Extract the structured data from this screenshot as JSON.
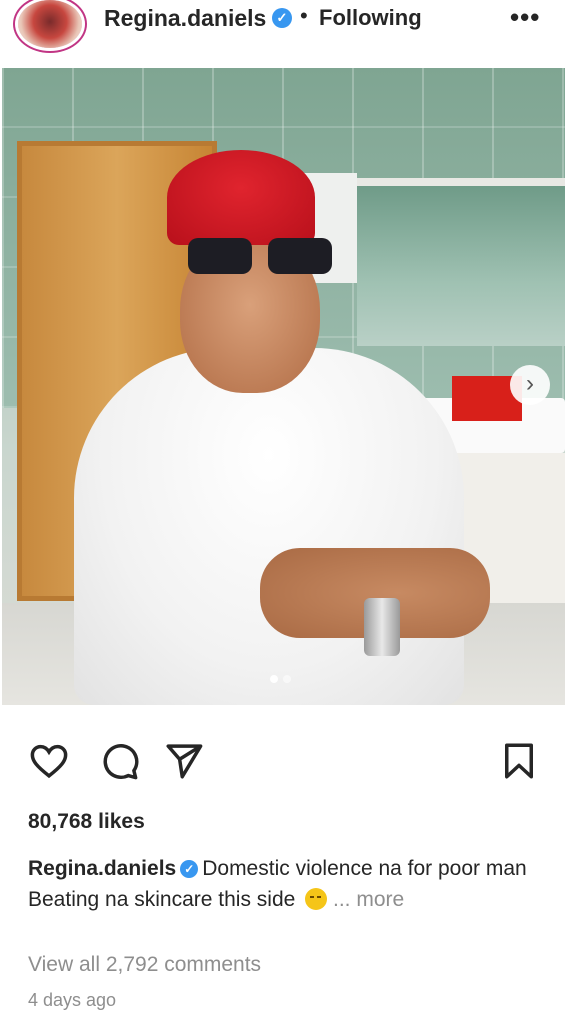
{
  "header": {
    "username": "Regina.daniels",
    "verified_glyph": "✓",
    "separator": "•",
    "follow_status": "Following",
    "more_glyph": "•••",
    "avatar_icon": "profile-avatar"
  },
  "post": {
    "carousel_next_glyph": "›",
    "carousel": {
      "total": 2,
      "active": 1
    }
  },
  "actions": {
    "like_icon": "heart-icon",
    "comment_icon": "comment-icon",
    "share_icon": "send-icon",
    "save_icon": "bookmark-icon"
  },
  "engagement": {
    "likes": "80,768 likes",
    "caption_user": "Regina.daniels",
    "caption_verified_glyph": "✓",
    "caption_line1": "Domestic violence na for poor man",
    "caption_line2": "Beating na skincare this side",
    "caption_emoji": "smirking-face-emoji",
    "more": "... more",
    "view_comments": "View all 2,792 comments",
    "timestamp": "4 days ago"
  },
  "colors": {
    "verified": "#3897f0",
    "text": "#262626",
    "muted": "#8e8e8e",
    "story_ring": "#c13584"
  }
}
